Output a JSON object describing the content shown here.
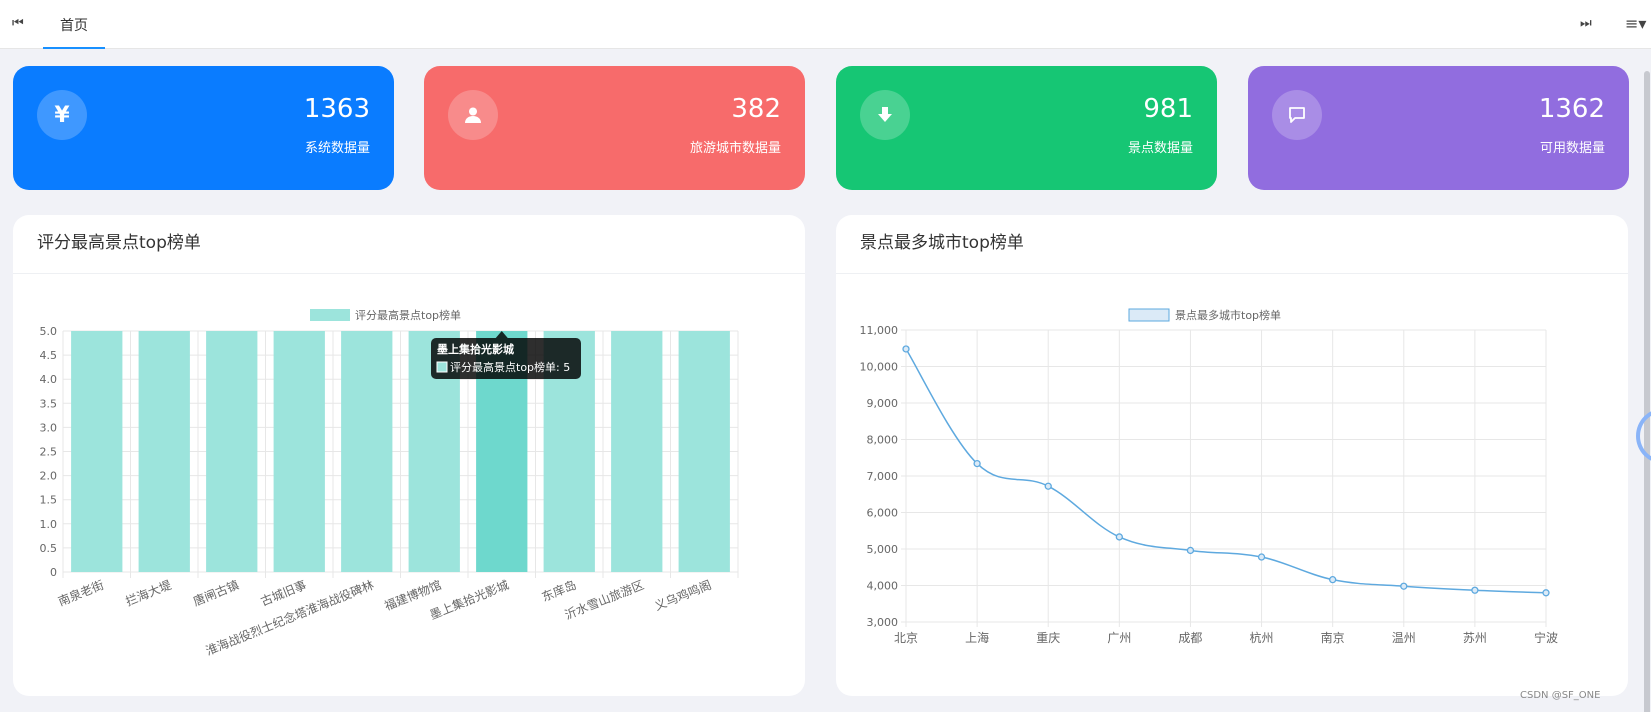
{
  "tabs": {
    "home_label": "首页",
    "prev_icon": "skip-start-icon",
    "next_icon": "skip-end-icon",
    "menu_icon": "menu-icon"
  },
  "stats": [
    {
      "value": "1363",
      "label": "系统数据量",
      "icon": "yen-icon",
      "color": "#0a7cff"
    },
    {
      "value": "382",
      "label": "旅游城市数据量",
      "icon": "user-icon",
      "color": "#f76b6b"
    },
    {
      "value": "981",
      "label": "景点数据量",
      "icon": "download-arrow-icon",
      "color": "#16c674"
    },
    {
      "value": "1362",
      "label": "可用数据量",
      "icon": "message-icon",
      "color": "#916ddf"
    }
  ],
  "panels": {
    "left_title": "评分最高景点top榜单",
    "right_title": "景点最多城市top榜单"
  },
  "chart_data": [
    {
      "type": "bar",
      "legend": "评分最高景点top榜单",
      "categories": [
        "南泉老街",
        "拦海大堤",
        "唐闸古镇",
        "古城旧事",
        "淮海战役烈士纪念塔淮海战役碑林",
        "福建博物馆",
        "墨上集拾光影城",
        "东庠岛",
        "沂水雪山旅游区",
        "义乌鸡鸣阁"
      ],
      "series": [
        {
          "name": "评分最高景点top榜单",
          "values": [
            5,
            5,
            5,
            5,
            5,
            5,
            5,
            5,
            5,
            5
          ]
        }
      ],
      "ylim": [
        0,
        5
      ],
      "yticks": [
        "0",
        "0.5",
        "1.0",
        "1.5",
        "2.0",
        "2.5",
        "3.0",
        "3.5",
        "4.0",
        "4.5",
        "5.0"
      ],
      "bar_color": "#9ce4dc",
      "hover_color": "#6ed8cd",
      "highlight_index": 6,
      "tooltip": {
        "title": "墨上集拾光影城",
        "text": "评分最高景点top榜单: 5"
      },
      "grid": true,
      "legend_position": "top"
    },
    {
      "type": "line",
      "legend": "景点最多城市top榜单",
      "categories": [
        "北京",
        "上海",
        "重庆",
        "广州",
        "成都",
        "杭州",
        "南京",
        "温州",
        "苏州",
        "宁波"
      ],
      "series": [
        {
          "name": "景点最多城市top榜单",
          "values": [
            10480,
            7340,
            6720,
            5330,
            4960,
            4780,
            4160,
            3980,
            3870,
            3800
          ]
        }
      ],
      "ylim": [
        3000,
        11000
      ],
      "yticks": [
        "3,000",
        "4,000",
        "5,000",
        "6,000",
        "7,000",
        "8,000",
        "9,000",
        "10,000",
        "11,000"
      ],
      "line_color": "#5ea9df",
      "grid": true,
      "smooth": true,
      "legend_position": "top"
    }
  ],
  "watermark": "CSDN @SF_ONE"
}
